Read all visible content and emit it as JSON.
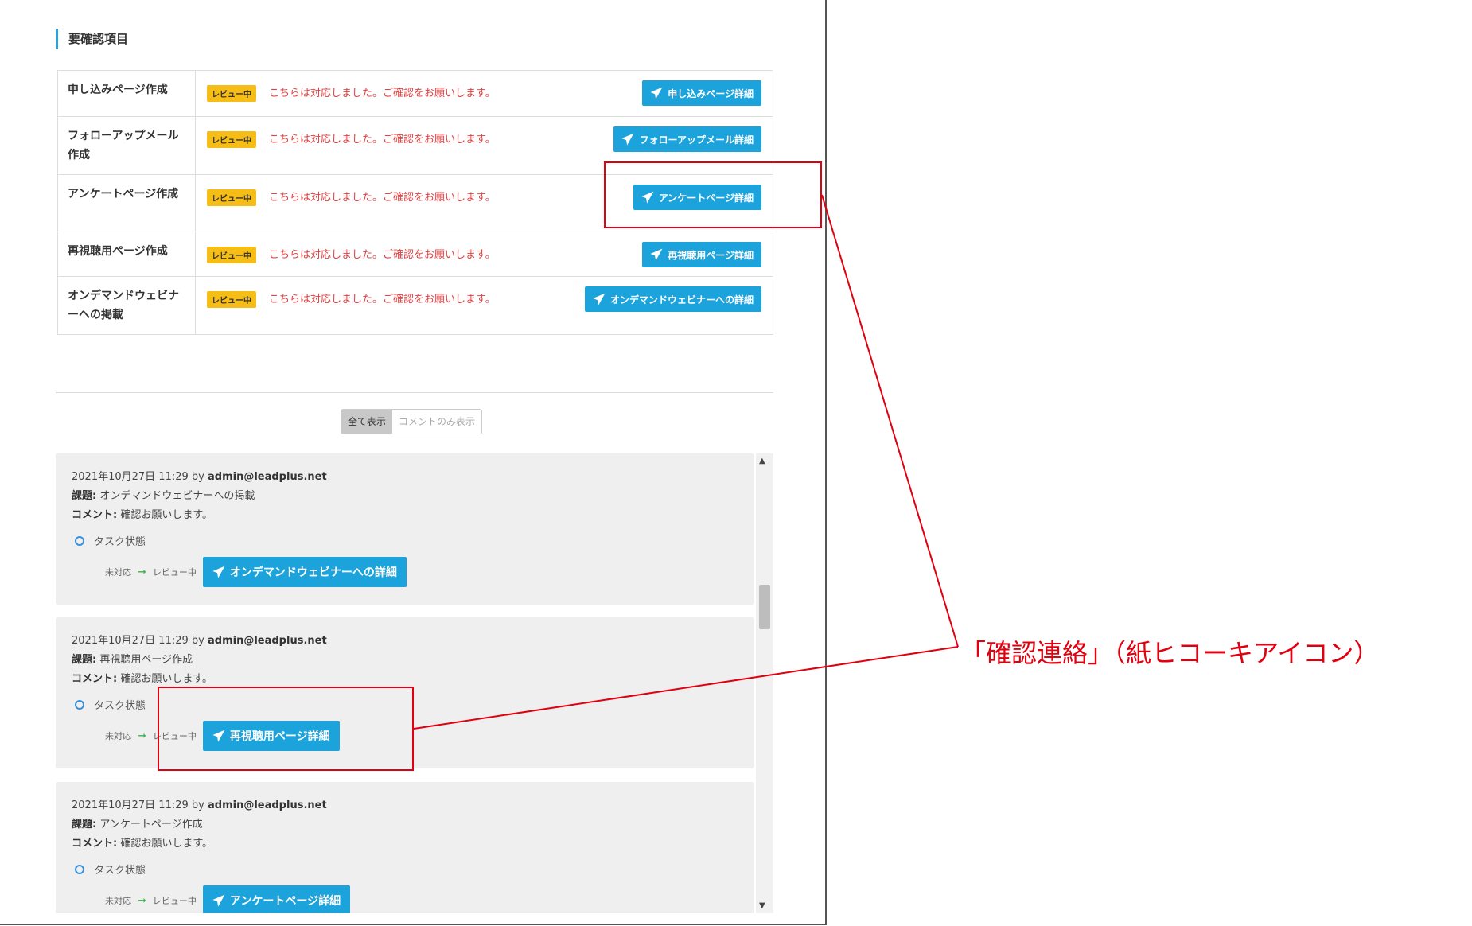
{
  "section_title": "要確認項目",
  "rows": [
    {
      "name": "申し込みページ作成",
      "badge": "レビュー中",
      "message": "こちらは対応しました。ご確認をお願いします。",
      "button": "申し込みページ詳細"
    },
    {
      "name": "フォローアップメール作成",
      "badge": "レビュー中",
      "message": "こちらは対応しました。ご確認をお願いします。",
      "button": "フォローアップメール詳細"
    },
    {
      "name": "アンケートページ作成",
      "badge": "レビュー中",
      "message": "こちらは対応しました。ご確認をお願いします。",
      "button": "アンケートページ詳細"
    },
    {
      "name": "再視聴用ページ作成",
      "badge": "レビュー中",
      "message": "こちらは対応しました。ご確認をお願いします。",
      "button": "再視聴用ページ詳細"
    },
    {
      "name": "オンデマンドウェビナーへの掲載",
      "badge": "レビュー中",
      "message": "こちらは対応しました。ご確認をお願いします。",
      "button": "オンデマンドウェビナーへの詳細"
    }
  ],
  "filter": {
    "all": "全て表示",
    "comments_only": "コメントのみ表示"
  },
  "log": [
    {
      "datetime": "2021年10月27日 11:29",
      "by": "by",
      "user": "admin@leadplus.net",
      "subject_label": "課題:",
      "subject": "オンデマンドウェビナーへの掲載",
      "comment_label": "コメント:",
      "comment": "確認お願いします。",
      "status_label": "タスク状態",
      "from": "未対応",
      "to": "レビュー中",
      "button": "オンデマンドウェビナーへの詳細"
    },
    {
      "datetime": "2021年10月27日 11:29",
      "by": "by",
      "user": "admin@leadplus.net",
      "subject_label": "課題:",
      "subject": "再視聴用ページ作成",
      "comment_label": "コメント:",
      "comment": "確認お願いします。",
      "status_label": "タスク状態",
      "from": "未対応",
      "to": "レビュー中",
      "button": "再視聴用ページ詳細"
    },
    {
      "datetime": "2021年10月27日 11:29",
      "by": "by",
      "user": "admin@leadplus.net",
      "subject_label": "課題:",
      "subject": "アンケートページ作成",
      "comment_label": "コメント:",
      "comment": "確認お願いします。",
      "status_label": "タスク状態",
      "from": "未対応",
      "to": "レビュー中",
      "button": "アンケートページ詳細"
    }
  ],
  "annotation": "「確認連絡」（紙ヒコーキアイコン）",
  "colors": {
    "accent": "#1da3db",
    "badge": "#f6bd16",
    "message": "#e14040",
    "annotation": "#e0000f"
  }
}
